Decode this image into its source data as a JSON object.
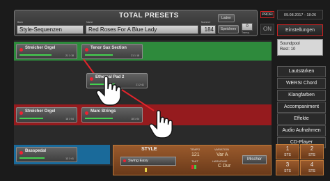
{
  "header": {
    "title": "TOTAL PRESETS",
    "bank_label": "Bank",
    "name_label": "Name",
    "number_label": "Nummer",
    "bank_value": "Style-Sequenzen",
    "preset_name": "Red Roses For A Blue Lady",
    "preset_number": "184",
    "laden_label": "Laden",
    "speichern_label": "Speichern",
    "counter_value": "0",
    "counter_label": "Transp."
  },
  "profi": {
    "label": "PROFI",
    "on_label": "ON"
  },
  "datetime": "09.08.2017 - 18:26",
  "settings_button": "Einstellungen",
  "soundpool": {
    "line1": "Soundpool",
    "line2": "Rest: 10"
  },
  "menu": [
    "Lautstärken",
    "WERSI Chord",
    "Klangfarben",
    "Accompaniment",
    "Effekte",
    "Audio Aufnahmen",
    "CD-Player"
  ],
  "slots": {
    "green_1": {
      "name": "Streicher Orgel",
      "num": "21 1·18",
      "level": 0.7
    },
    "green_2": {
      "name": "Tenor Sax Section",
      "num": "21 1·18",
      "level": 0.6
    },
    "drag": {
      "name": "Ethereal Pad 2",
      "num": "21 2·41",
      "level": 0.55
    },
    "red_1": {
      "name": "Streicher Orgel",
      "num": "18 1·04",
      "level": 0.5
    },
    "red_2": {
      "name": "Marc Strings",
      "num": "18 1·04",
      "level": 0.6
    },
    "blue_1": {
      "name": "Basspedal",
      "num": "13 1·41",
      "level": 0.55
    }
  },
  "style": {
    "title": "STYLE",
    "style_name": "Swing Easy",
    "tempo_label": "TEMPO",
    "tempo_value": "121",
    "variation_label": "VARIATION",
    "variation_value": "Var A",
    "takt_label": "TAKT",
    "harmonie_label": "HARMONIE",
    "harmonie_value": "C Dur",
    "mischer_label": "Mischer"
  },
  "sts": [
    {
      "num": "1",
      "label": "STS"
    },
    {
      "num": "2",
      "label": "STS"
    },
    {
      "num": "3",
      "label": "STS"
    },
    {
      "num": "4",
      "label": "STS"
    }
  ],
  "icons": {
    "hand": "hand-pointer-icon"
  },
  "colors": {
    "green_band": "#2e8a3c",
    "red_band": "#951b1e",
    "blue_band": "#1a6a9a",
    "accent_red": "#e3242b",
    "style_orange": "#9a5a2c"
  }
}
